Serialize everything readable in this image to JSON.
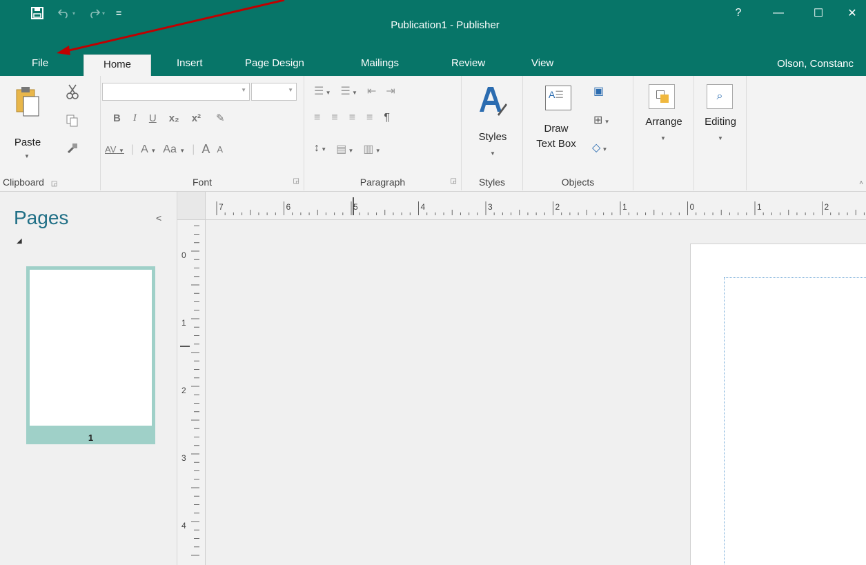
{
  "window": {
    "title": "Publication1 - Publisher",
    "controls": {
      "help": "?",
      "minimize": "—",
      "maximize": "☐",
      "close": "✕"
    }
  },
  "quick_access": {
    "save_icon": "save-icon",
    "undo_icon": "undo-icon",
    "redo_icon": "redo-icon",
    "customize": "="
  },
  "tabs": [
    {
      "label": "File"
    },
    {
      "label": "Home",
      "active": true
    },
    {
      "label": "Insert"
    },
    {
      "label": "Page Design"
    },
    {
      "label": "Mailings"
    },
    {
      "label": "Review"
    },
    {
      "label": "View"
    }
  ],
  "user": "Olson, Constanc",
  "ribbon": {
    "clipboard": {
      "label": "Clipboard",
      "paste": "Paste"
    },
    "font": {
      "label": "Font",
      "font_name": "",
      "font_size": "",
      "bold": "B",
      "italic": "I",
      "underline": "U",
      "subscript": "x₂",
      "superscript": "x²",
      "char_spacing": "AV",
      "font_color": "A",
      "change_case": "Aa",
      "grow": "A",
      "shrink": "A"
    },
    "paragraph": {
      "label": "Paragraph",
      "pilcrow": "¶"
    },
    "styles": {
      "label": "Styles",
      "button": "Styles"
    },
    "objects": {
      "label": "Objects",
      "draw_text_box_line1": "Draw",
      "draw_text_box_line2": "Text Box",
      "box_glyph": "A"
    },
    "arrange": {
      "label": "Arrange"
    },
    "editing": {
      "label": "Editing"
    }
  },
  "pages_pane": {
    "title": "Pages",
    "collapse": "<",
    "page_number": "1"
  },
  "hruler_labels": [
    "7",
    "6",
    "5",
    "4",
    "3",
    "2",
    "1",
    "0",
    "1",
    "2"
  ],
  "vruler_labels": [
    "0",
    "1",
    "2",
    "3",
    "4"
  ],
  "colors": {
    "accent": "#077568",
    "thumb_selected": "#9fd0c8",
    "pages_title": "#1f6f86",
    "annotation_arrow": "#c00000"
  }
}
